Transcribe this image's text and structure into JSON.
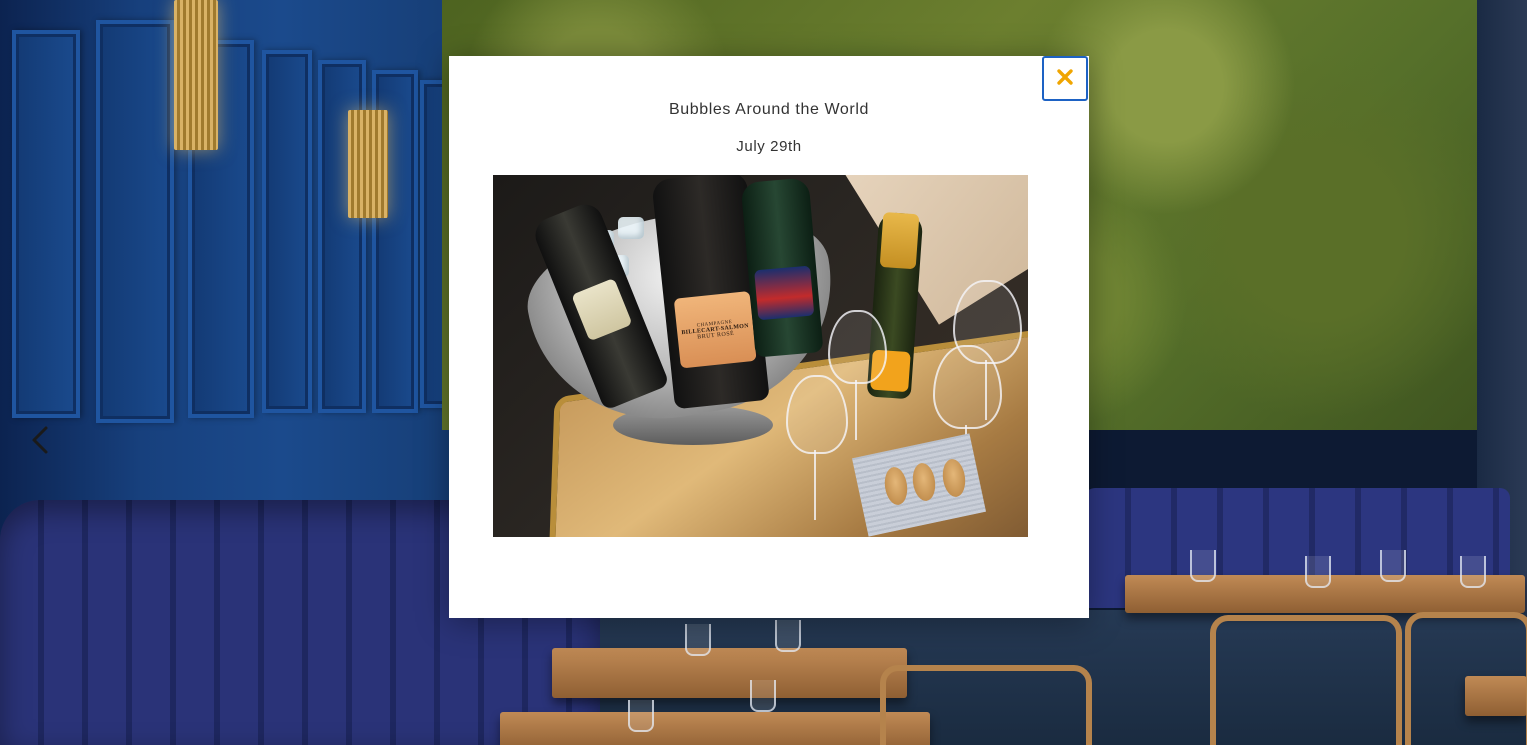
{
  "carousel": {
    "prev_icon": "chevron-left-icon"
  },
  "modal": {
    "title": "Bubbles Around the World",
    "date": "July 29th",
    "close_icon": "close-icon",
    "close_color": "#f0a500",
    "close_border_color": "#1d62c4",
    "image_alt": ""
  },
  "event_photo": {
    "bottle_labels": [
      {
        "brand": "CHAMPAGNE",
        "name": "BILLECART-SALMON",
        "type": "BRUT ROSÉ"
      }
    ]
  }
}
